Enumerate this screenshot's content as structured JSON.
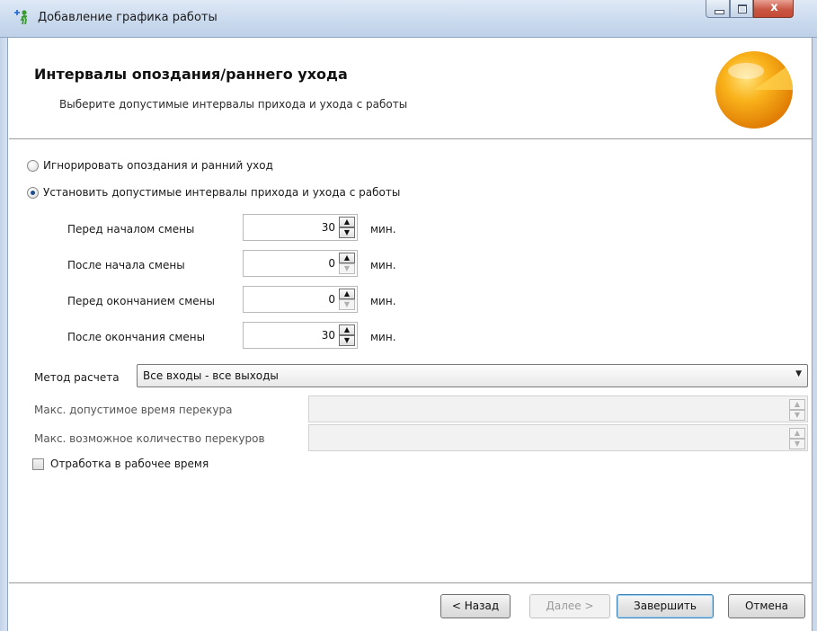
{
  "window": {
    "title": "Добавление графика работы",
    "close_glyph": "x",
    "icon": "person-add-icon"
  },
  "header": {
    "title": "Интервалы опоздания/раннего ухода",
    "subtitle": "Выберите допустимые интервалы прихода и ухода с работы",
    "logo": "orange-sphere-logo"
  },
  "mode": {
    "options": [
      {
        "label": "Игнорировать опоздания и ранний уход",
        "selected": false
      },
      {
        "label": "Установить допустимые интервалы прихода и ухода с работы",
        "selected": true
      }
    ]
  },
  "intervals": [
    {
      "label": "Перед началом смены",
      "value": "30",
      "unit": "мин."
    },
    {
      "label": "После начала смены",
      "value": "0",
      "unit": "мин."
    },
    {
      "label": "Перед окончанием смены",
      "value": "0",
      "unit": "мин."
    },
    {
      "label": "После окончания смены",
      "value": "30",
      "unit": "мин."
    }
  ],
  "calc_method": {
    "label": "Метод расчета",
    "value": "Все входы - все выходы"
  },
  "smoke_break": {
    "max_time_label": "Макс. допустимое время перекура",
    "max_count_label": "Макс. возможное количество перекуров"
  },
  "work_time": {
    "label": "Отработка в рабочее время",
    "checked": false
  },
  "footer": {
    "back": "< Назад",
    "next": "Далее >",
    "finish": "Завершить",
    "cancel": "Отмена"
  },
  "colors": {
    "titlebar": "#c9d9ed",
    "close_button": "#c95744",
    "accent_default_button": "#3c7fb1",
    "logo_orange": "#f5a00b"
  }
}
